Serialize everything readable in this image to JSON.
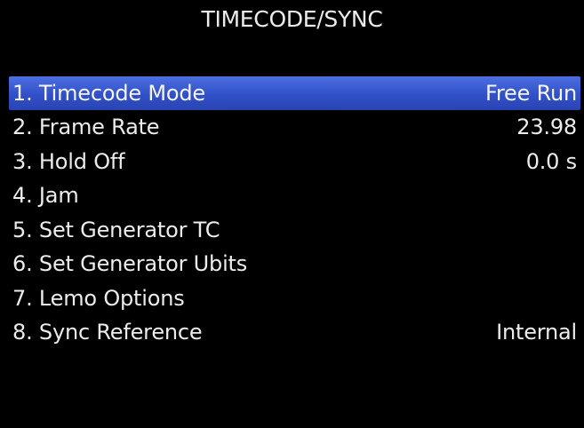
{
  "screen": {
    "title": "TIMECODE/SYNC"
  },
  "colors": {
    "background": "#000000",
    "text": "#ececec",
    "selection": "#3a59d1"
  },
  "menu": {
    "selected_index": 0,
    "items": [
      {
        "label": "1. Timecode Mode",
        "value": "Free Run"
      },
      {
        "label": "2. Frame Rate",
        "value": "23.98"
      },
      {
        "label": "3. Hold Off",
        "value": "0.0 s"
      },
      {
        "label": "4. Jam",
        "value": ""
      },
      {
        "label": "5. Set Generator TC",
        "value": ""
      },
      {
        "label": "6. Set Generator Ubits",
        "value": ""
      },
      {
        "label": "7. Lemo Options",
        "value": ""
      },
      {
        "label": "8. Sync Reference",
        "value": "Internal"
      }
    ]
  }
}
